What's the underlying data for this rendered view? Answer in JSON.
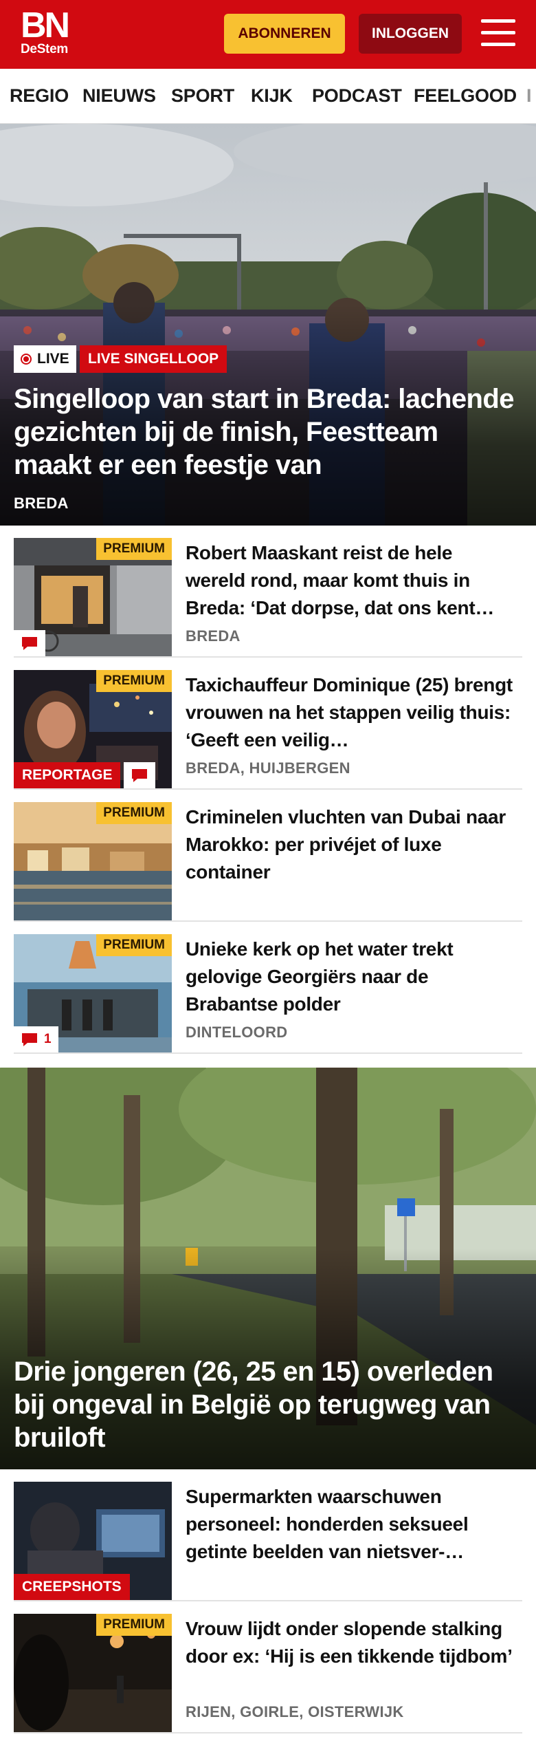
{
  "header": {
    "brand_top": "BN",
    "brand_bottom": "DeStem",
    "subscribe_label": "ABONNEREN",
    "login_label": "INLOGGEN",
    "menu_icon": "hamburger-menu-icon",
    "colors": {
      "brand_red": "#d10a11",
      "subscribe_yellow": "#f8c131",
      "login_dark_red": "#8e0a12"
    }
  },
  "nav": {
    "items": [
      {
        "label": "REGIO"
      },
      {
        "label": "NIEUWS"
      },
      {
        "label": "SPORT"
      },
      {
        "label": "KIJK"
      },
      {
        "label": "PODCAST"
      },
      {
        "label": "FEELGOOD"
      },
      {
        "label": "I"
      }
    ]
  },
  "hero1": {
    "live_label": "LIVE",
    "tag_label": "LIVE SINGELLOOP",
    "title": "Singelloop van start in Breda: lachende gezichten bij de finish, Feestteam maakt er een feestje van",
    "location": "BREDA"
  },
  "articles1": [
    {
      "premium": "PREMIUM",
      "title": "Robert Maaskant reist de hele wereld rond, maar komt thuis in Breda: ‘Dat dorpse, dat ons kent…",
      "location": "BREDA",
      "comment_icon": "comment-icon"
    },
    {
      "premium": "PREMIUM",
      "tag": "REPORTAGE",
      "title": "Taxichauffeur Dominique (25) brengt vrouwen na het stappen veilig thuis: ‘Geeft een veilig…",
      "location": "BREDA, HUIJBERGEN",
      "comment_icon": "comment-icon"
    },
    {
      "premium": "PREMIUM",
      "title": "Criminelen vluchten van Dubai naar Marokko: per privéjet of luxe container"
    },
    {
      "premium": "PREMIUM",
      "title": "Unieke kerk op het water trekt gelovige Georgiërs naar de Brabantse polder",
      "location": "DINTELOORD",
      "comment_icon": "comment-icon",
      "comment_count": "1"
    }
  ],
  "hero2": {
    "title": "Drie jongeren (26, 25 en 15) overleden bij ongeval in België op terugweg van bruiloft"
  },
  "articles2": [
    {
      "tag": "CREEPSHOTS",
      "title": "Supermarkten waarschuwen personeel: honderden seksueel getinte beelden van nietsver-…"
    },
    {
      "premium": "PREMIUM",
      "title": "Vrouw lijdt onder slopende stalking door ex: ‘Hij is een tikkende tijdbom’",
      "location": "RIJEN, GOIRLE, OISTERWIJK"
    }
  ]
}
